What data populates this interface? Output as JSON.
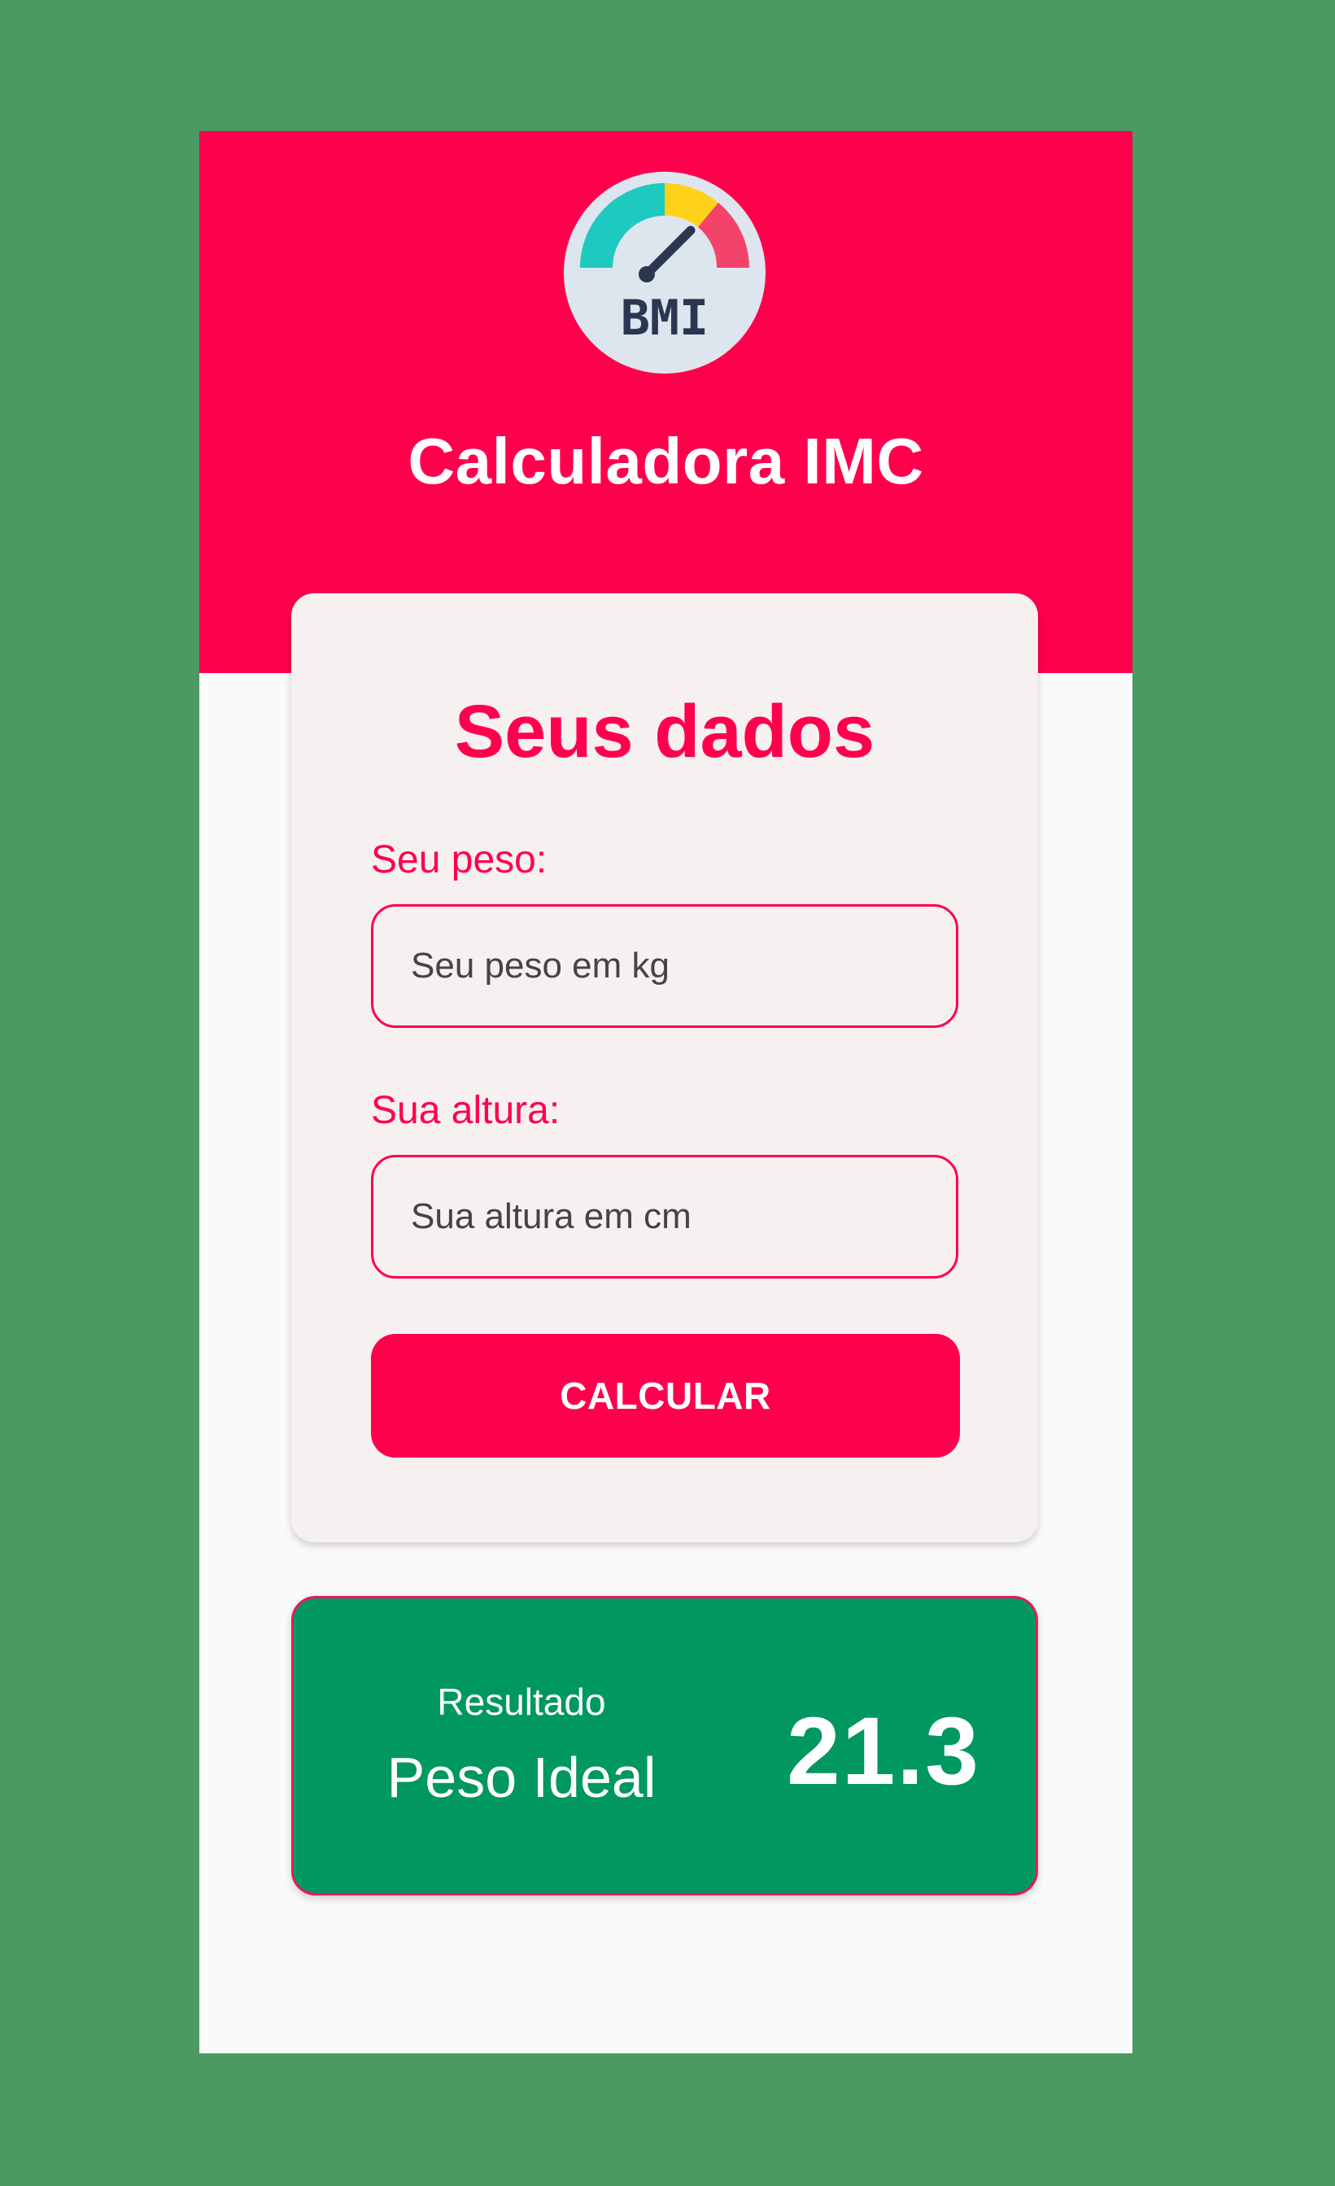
{
  "app": {
    "title": "Calculadora IMC",
    "logo_text": "BMI",
    "logo_icon": "bmi-gauge-icon"
  },
  "form": {
    "title": "Seus dados",
    "weight": {
      "label": "Seu peso:",
      "placeholder": "Seu peso em kg"
    },
    "height": {
      "label": "Sua altura:",
      "placeholder": "Sua altura em cm"
    },
    "submit_label": "CALCULAR"
  },
  "result": {
    "label": "Resultado",
    "status": "Peso Ideal",
    "value": "21.3"
  },
  "colors": {
    "primary": "#ff004d",
    "result_bg": "#009760",
    "backdrop": "#4c9964",
    "card_bg": "#f6f0f1"
  }
}
